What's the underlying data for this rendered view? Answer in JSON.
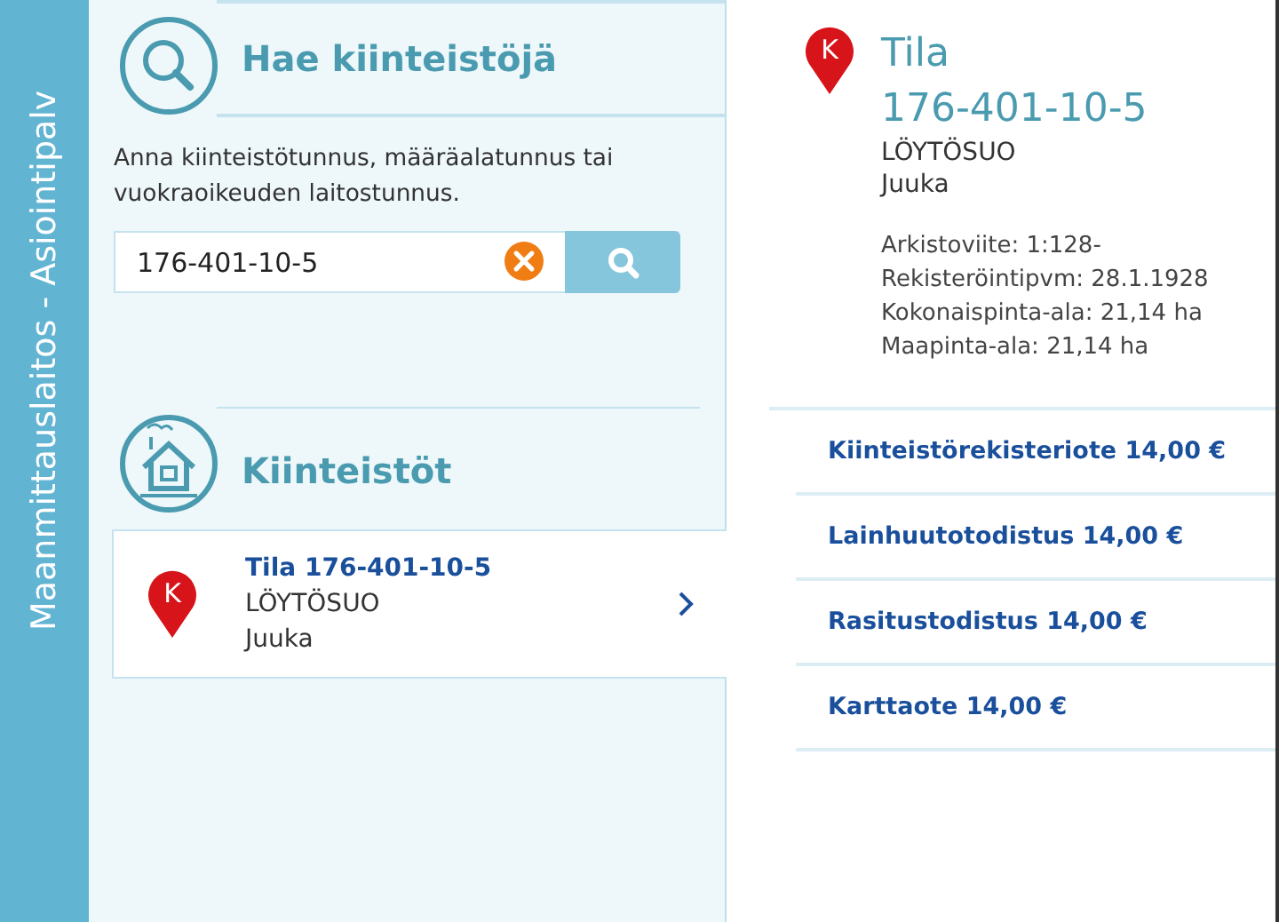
{
  "sidebar": {
    "title": "Maanmittauslaitos - Asiointipalv"
  },
  "search": {
    "heading": "Hae kiinteistöjä",
    "instructions": "Anna kiinteistötunnus, määräalatunnus tai vuokraoikeuden laitostunnus.",
    "value": "176-401-10-5"
  },
  "results": {
    "heading": "Kiinteistöt",
    "items": [
      {
        "marker": "K",
        "title": "Tila 176-401-10-5",
        "name": "LÖYTÖSUO",
        "municipality": "Juuka",
        "selected": true
      }
    ]
  },
  "detail": {
    "marker": "K",
    "type": "Tila",
    "id": "176-401-10-5",
    "name": "LÖYTÖSUO",
    "municipality": "Juuka",
    "facts": [
      "Arkistoviite: 1:128-",
      "Rekisteröintipvm: 28.1.1928",
      "Kokonaispinta-ala: 21,14 ha",
      "Maapinta-ala: 21,14 ha"
    ],
    "products": [
      "Kiinteistörekisteriote 14,00 €",
      "Lainhuutotodistus 14,00 €",
      "Rasitustodistus 14,00 €",
      "Karttaote 14,00 €"
    ]
  }
}
